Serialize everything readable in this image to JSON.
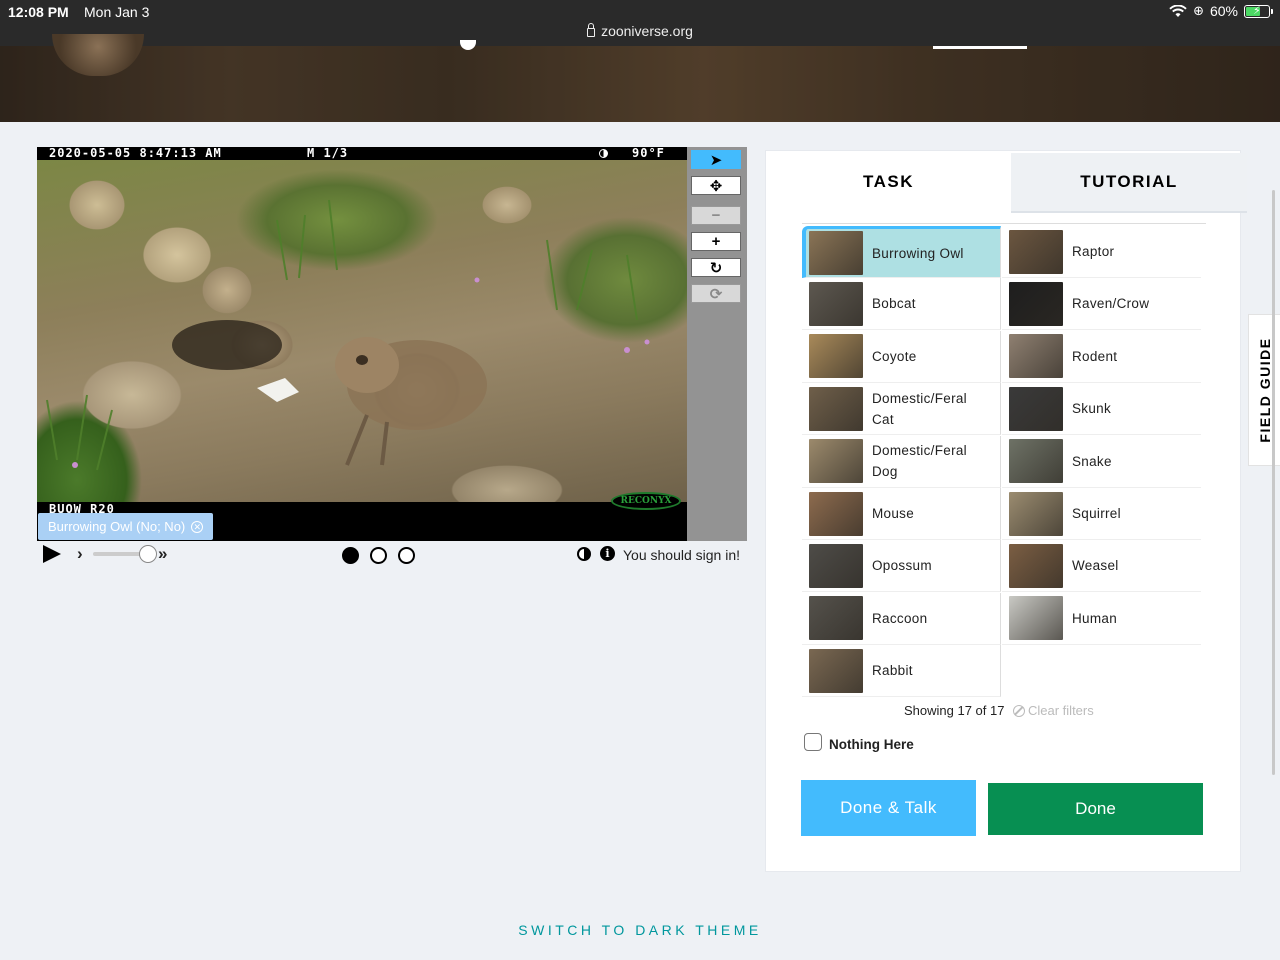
{
  "status_bar": {
    "time": "12:08 PM",
    "date": "Mon Jan 3",
    "battery": "60%",
    "url": "zooniverse.org"
  },
  "viewer": {
    "camera_datetime": "2020-05-05 8:47:13 AM",
    "camera_frame": "M 1/3",
    "camera_temp": "90°F",
    "camera_id": "BUOW R20",
    "camera_brand": "RECONYX",
    "annotation_tag": "Burrowing Owl (No; No)",
    "toolbar": [
      {
        "name": "pointer-tool",
        "icon": "➤",
        "state": "active"
      },
      {
        "name": "move-tool",
        "icon": "✥",
        "state": "normal"
      },
      {
        "name": "zoom-out-tool",
        "icon": "−",
        "state": "disabled"
      },
      {
        "name": "zoom-in-tool",
        "icon": "+",
        "state": "normal"
      },
      {
        "name": "rotate-tool",
        "icon": "↻",
        "state": "normal"
      },
      {
        "name": "reset-tool",
        "icon": "⟳",
        "state": "disabled"
      }
    ],
    "frames": {
      "count": 3,
      "current": 1
    },
    "sign_in_message": "You should sign in!"
  },
  "task_panel": {
    "tabs": {
      "task": "TASK",
      "tutorial": "TUTORIAL"
    },
    "choices": [
      {
        "label": "Burrowing Owl",
        "color": "#8a7456",
        "selected": true
      },
      {
        "label": "Raptor",
        "color": "#6b5640"
      },
      {
        "label": "Bobcat",
        "color": "#5d5850"
      },
      {
        "label": "Raven/Crow",
        "color": "#1e1e1e"
      },
      {
        "label": "Coyote",
        "color": "#a98a5a"
      },
      {
        "label": "Rodent",
        "color": "#8f8071"
      },
      {
        "label": "Domestic/Feral Cat",
        "color": "#6f5f4a"
      },
      {
        "label": "Skunk",
        "color": "#3a3a3a"
      },
      {
        "label": "Domestic/Feral Dog",
        "color": "#9c8a6c"
      },
      {
        "label": "Snake",
        "color": "#6e7266"
      },
      {
        "label": "Mouse",
        "color": "#8d6b4e"
      },
      {
        "label": "Squirrel",
        "color": "#9b8c70"
      },
      {
        "label": "Opossum",
        "color": "#4e4c48"
      },
      {
        "label": "Weasel",
        "color": "#7b5e43"
      },
      {
        "label": "Raccoon",
        "color": "#55524c"
      },
      {
        "label": "Human",
        "color": "#c9c9c4"
      },
      {
        "label": "Rabbit",
        "color": "#7a6852"
      }
    ],
    "showing": "Showing 17 of 17",
    "clear_filters": "Clear filters",
    "nothing_here": "Nothing Here",
    "done_talk": "Done & Talk",
    "done": "Done",
    "accent": "#43bbfd",
    "done_color": "#078f52"
  },
  "field_guide": "FIELD GUIDE",
  "footer": {
    "switch_theme": "SWITCH TO DARK THEME"
  }
}
